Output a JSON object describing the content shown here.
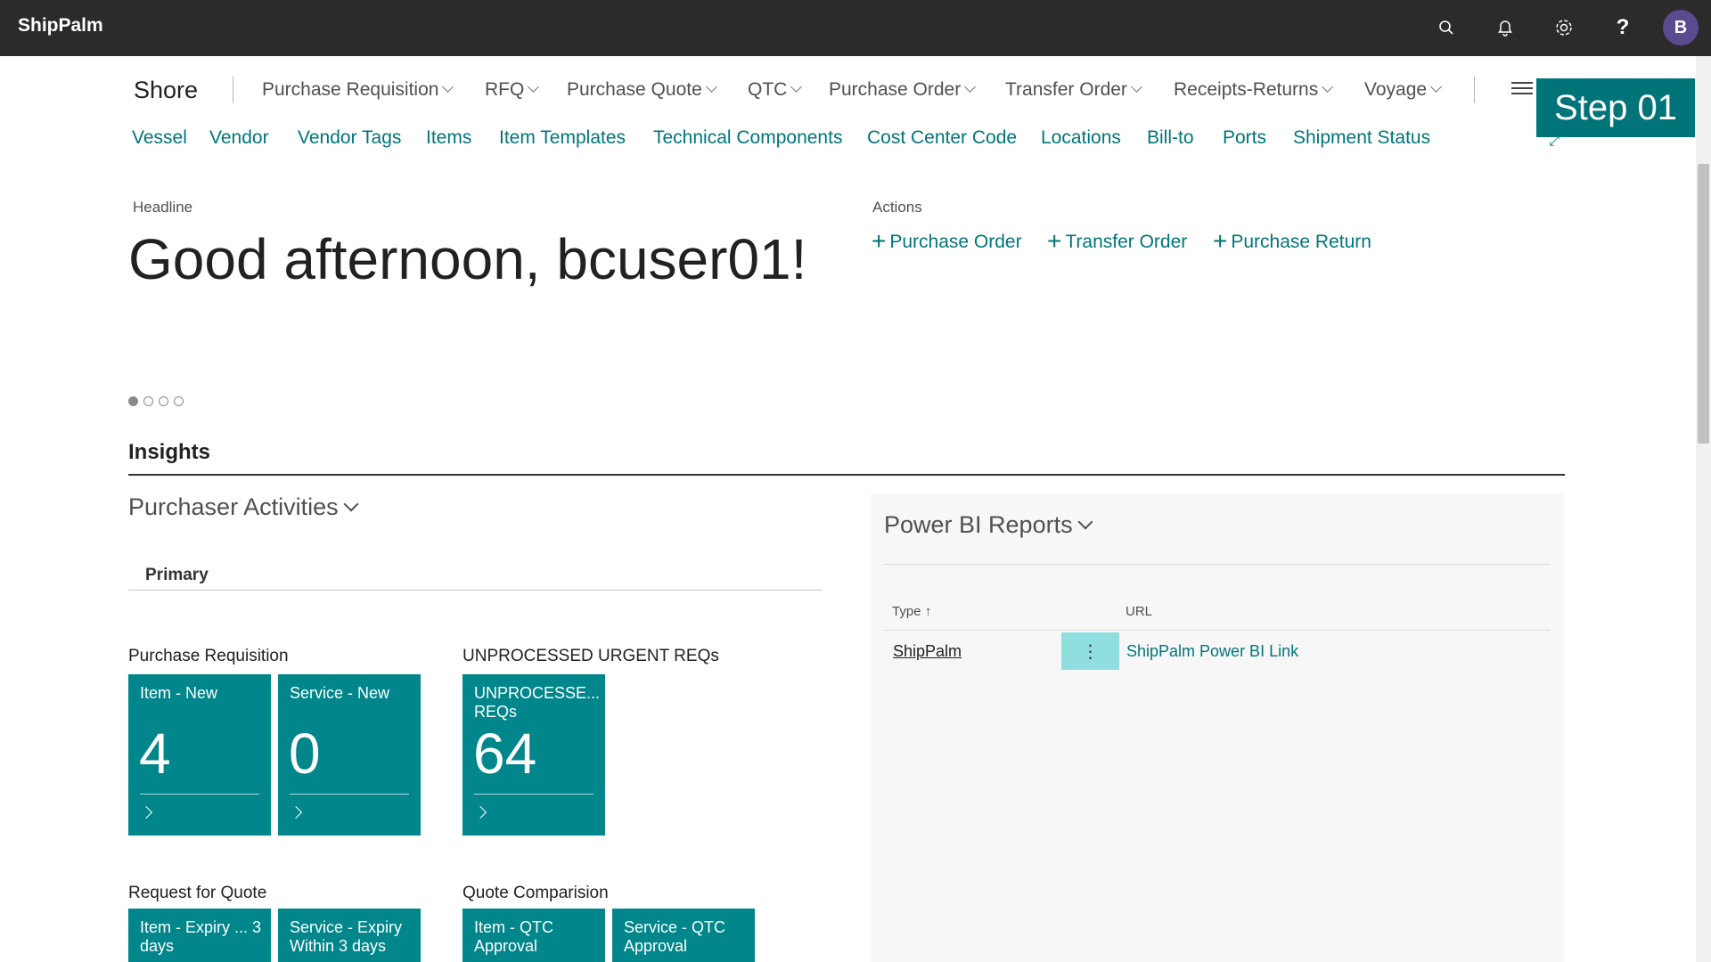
{
  "app": {
    "brand": "ShipPalm"
  },
  "topbar": {
    "search_icon": "search-icon",
    "bell_icon": "bell-icon",
    "settings_icon": "gear-icon",
    "help_label": "?",
    "avatar_initial": "B"
  },
  "nav": {
    "role_title": "Shore",
    "menus": [
      "Purchase Requisition",
      "RFQ",
      "Purchase Quote",
      "QTC",
      "Purchase Order",
      "Transfer Order",
      "Receipts-Returns",
      "Voyage"
    ],
    "links": [
      "Vessel",
      "Vendor",
      "Vendor Tags",
      "Items",
      "Item Templates",
      "Technical Components",
      "Cost Center Code",
      "Locations",
      "Bill-to",
      "Ports",
      "Shipment Status"
    ]
  },
  "step_badge": "Step 01",
  "headline": {
    "label": "Headline",
    "greeting": "Good afternoon, bcuser01!"
  },
  "actions": {
    "label": "Actions",
    "items": [
      "Purchase Order",
      "Transfer Order",
      "Purchase Return"
    ]
  },
  "insights": {
    "title": "Insights"
  },
  "purchaser_activities": {
    "title": "Purchaser Activities",
    "tab": "Primary",
    "groups": {
      "purchase_requisition": {
        "title": "Purchase Requisition",
        "tiles": [
          {
            "label": "Item - New",
            "value": "4"
          },
          {
            "label": "Service - New",
            "value": "0"
          }
        ]
      },
      "unprocessed": {
        "title": "UNPROCESSED URGENT REQs",
        "tiles": [
          {
            "label": "UNPROCESSE... REQs",
            "value": "64"
          }
        ]
      },
      "rfq": {
        "title": "Request for Quote",
        "tiles": [
          {
            "label": "Item - Expiry ... 3 days"
          },
          {
            "label": "Service - Expiry Within 3 days"
          }
        ]
      },
      "quote_comparison": {
        "title": "Quote Comparision",
        "tiles": [
          {
            "label": "Item - QTC Approval"
          },
          {
            "label": "Service - QTC Approval"
          }
        ]
      }
    }
  },
  "power_bi": {
    "title": "Power BI Reports",
    "columns": {
      "type": "Type",
      "sort_indicator": "↑",
      "url": "URL"
    },
    "rows": [
      {
        "type": "ShipPalm",
        "menu": "⋮",
        "url": "ShipPalm Power BI Link"
      }
    ]
  },
  "colors": {
    "accent": "#00757a",
    "tile": "#00868b",
    "topbar": "#2b2b2b",
    "badge": "#007479"
  }
}
